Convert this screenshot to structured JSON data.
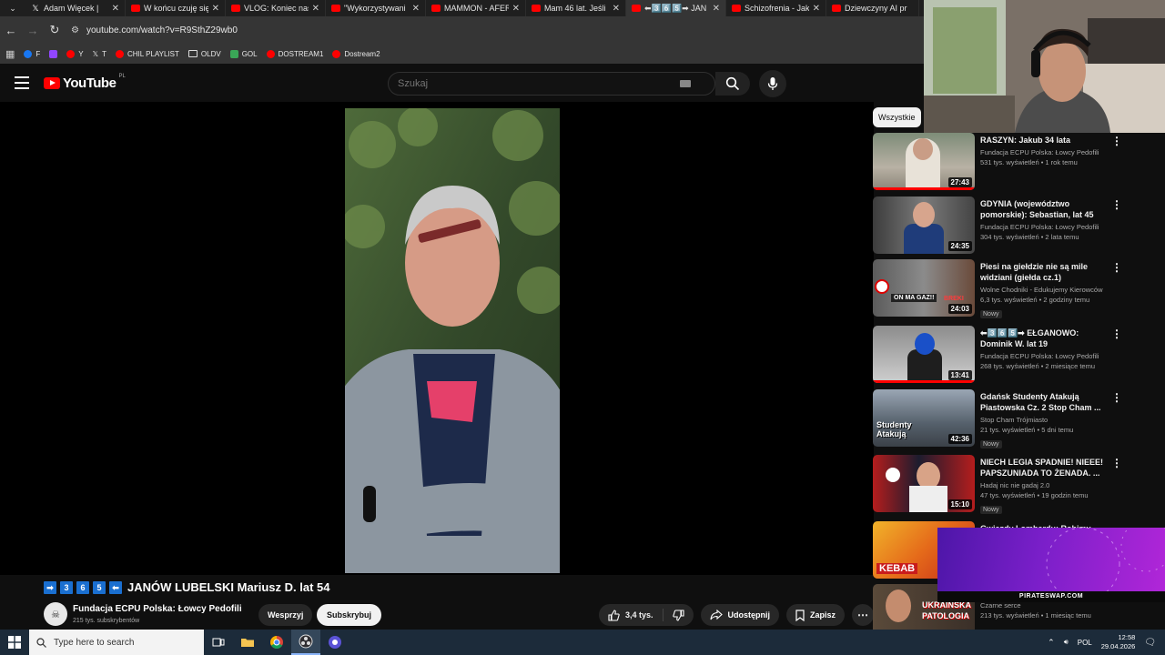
{
  "browser": {
    "tabs": [
      {
        "title": "Adam Więcek |",
        "icon": "x-logo-icon",
        "active": false
      },
      {
        "title": "W końcu czuję się",
        "icon": "youtube-icon",
        "active": false
      },
      {
        "title": "VLOG: Koniec nas",
        "icon": "youtube-icon",
        "active": false
      },
      {
        "title": "\"Wykorzystywani",
        "icon": "youtube-icon",
        "active": false
      },
      {
        "title": "MAMMON - AFER",
        "icon": "youtube-icon",
        "active": false
      },
      {
        "title": "Mam 46 lat. Jeśli",
        "icon": "youtube-icon",
        "active": false
      },
      {
        "title": "⬅3️⃣6️⃣5️⃣➡ JAN",
        "icon": "youtube-icon",
        "active": true
      },
      {
        "title": "Schizofrenia - Jak",
        "icon": "youtube-icon",
        "active": false
      },
      {
        "title": "Dziewczyny AI pr",
        "icon": "youtube-icon",
        "active": false
      }
    ],
    "url": "youtube.com/watch?v=R9SthZ29wb0",
    "bookmarks": [
      {
        "label": "F",
        "color": "#1877f2"
      },
      {
        "label": "",
        "color": "#9146ff"
      },
      {
        "label": "Y",
        "color": "#ff0000"
      },
      {
        "label": "T",
        "color": "#000000"
      },
      {
        "label": "CHIL PLAYLIST",
        "color": "#ff0000"
      },
      {
        "label": "OLDV",
        "color": "folder"
      },
      {
        "label": "GOL",
        "color": "#3aa757"
      },
      {
        "label": "DOSTREAM1",
        "color": "#ff0000"
      },
      {
        "label": "Dostream2",
        "color": "#ff0000"
      }
    ]
  },
  "header": {
    "logo_text": "YouTube",
    "logo_country": "PL",
    "search_placeholder": "Szukaj"
  },
  "video": {
    "title_prefix_digits": [
      "3",
      "6",
      "5"
    ],
    "title": "JANÓW LUBELSKI Mariusz D. lat 54",
    "channel": "Fundacja ECPU Polska: Łowcy Pedofili",
    "subscribers": "215 tys. subskrybentów",
    "join_label": "Wesprzyj",
    "subscribe_label": "Subskrybuj",
    "likes": "3,4 tys.",
    "share_label": "Udostępnij",
    "save_label": "Zapisz"
  },
  "sidebar": {
    "chip": "Wszystkie",
    "items": [
      {
        "title": "RASZYN: Jakub 34 lata",
        "channel": "Fundacja ECPU Polska: Łowcy Pedofili",
        "meta": "531 tys. wyświetleń • 1 rok temu",
        "duration": "27:43",
        "badge": "",
        "progress": 1.0
      },
      {
        "title": "GDYNIA (województwo pomorskie): Sebastian, lat 45",
        "channel": "Fundacja ECPU Polska: Łowcy Pedofili",
        "meta": "304 tys. wyświetleń • 2 lata temu",
        "duration": "24:35",
        "badge": "",
        "progress": 0
      },
      {
        "title": "Piesi na giełdzie nie są mile widziani (giełda cz.1)",
        "channel": "Wolne Chodniki - Edukujemy Kierowców",
        "meta": "6,3 tys. wyświetleń • 2 godziny temu",
        "duration": "24:03",
        "badge": "Nowy",
        "progress": 0
      },
      {
        "title": "⬅3️⃣6️⃣5️⃣➡ EŁGANOWO: Dominik W. lat 19",
        "channel": "Fundacja ECPU Polska: Łowcy Pedofili",
        "meta": "268 tys. wyświetleń • 2 miesiące temu",
        "duration": "13:41",
        "badge": "",
        "progress": 1.0
      },
      {
        "title": "Gdańsk Studenty Atakują Piastowska Cz. 2 Stop Cham ...",
        "channel": "Stop Cham Trójmiasto",
        "meta": "21 tys. wyświetleń • 5 dni temu",
        "duration": "42:36",
        "badge": "Nowy",
        "progress": 0
      },
      {
        "title": "NIECH LEGIA SPADNIE! NIEEE! PAPSZUNIADA TO ŻENADA. ...",
        "channel": "Hadaj nic nie gadaj 2.0",
        "meta": "47 tys. wyświetleń • 19 godzin temu",
        "duration": "15:10",
        "badge": "Nowy",
        "progress": 0
      },
      {
        "title": "Gwiazdy Lombardu: Robimy",
        "channel": "",
        "meta": "",
        "duration": "",
        "badge": "",
        "progress": 0
      },
      {
        "title": "",
        "channel": "Czarne serce",
        "meta": "213 tys. wyświetleń • 1 miesiąc temu",
        "duration": "",
        "badge": "",
        "progress": 0
      }
    ]
  },
  "thumb_texts": {
    "t3a": "ON MA GAZ!!",
    "t3b": "BREKI",
    "t5": "Studenty Atakują",
    "t7": "KEBAB",
    "t8a": "UKRAINSKA",
    "t8b": "PATOLOGIA"
  },
  "overlay": {
    "label": "PIRATESWAP.COM"
  },
  "taskbar": {
    "search_placeholder": "Type here to search",
    "lang": "POL",
    "time": "12:58",
    "date": "29.04.2026"
  }
}
